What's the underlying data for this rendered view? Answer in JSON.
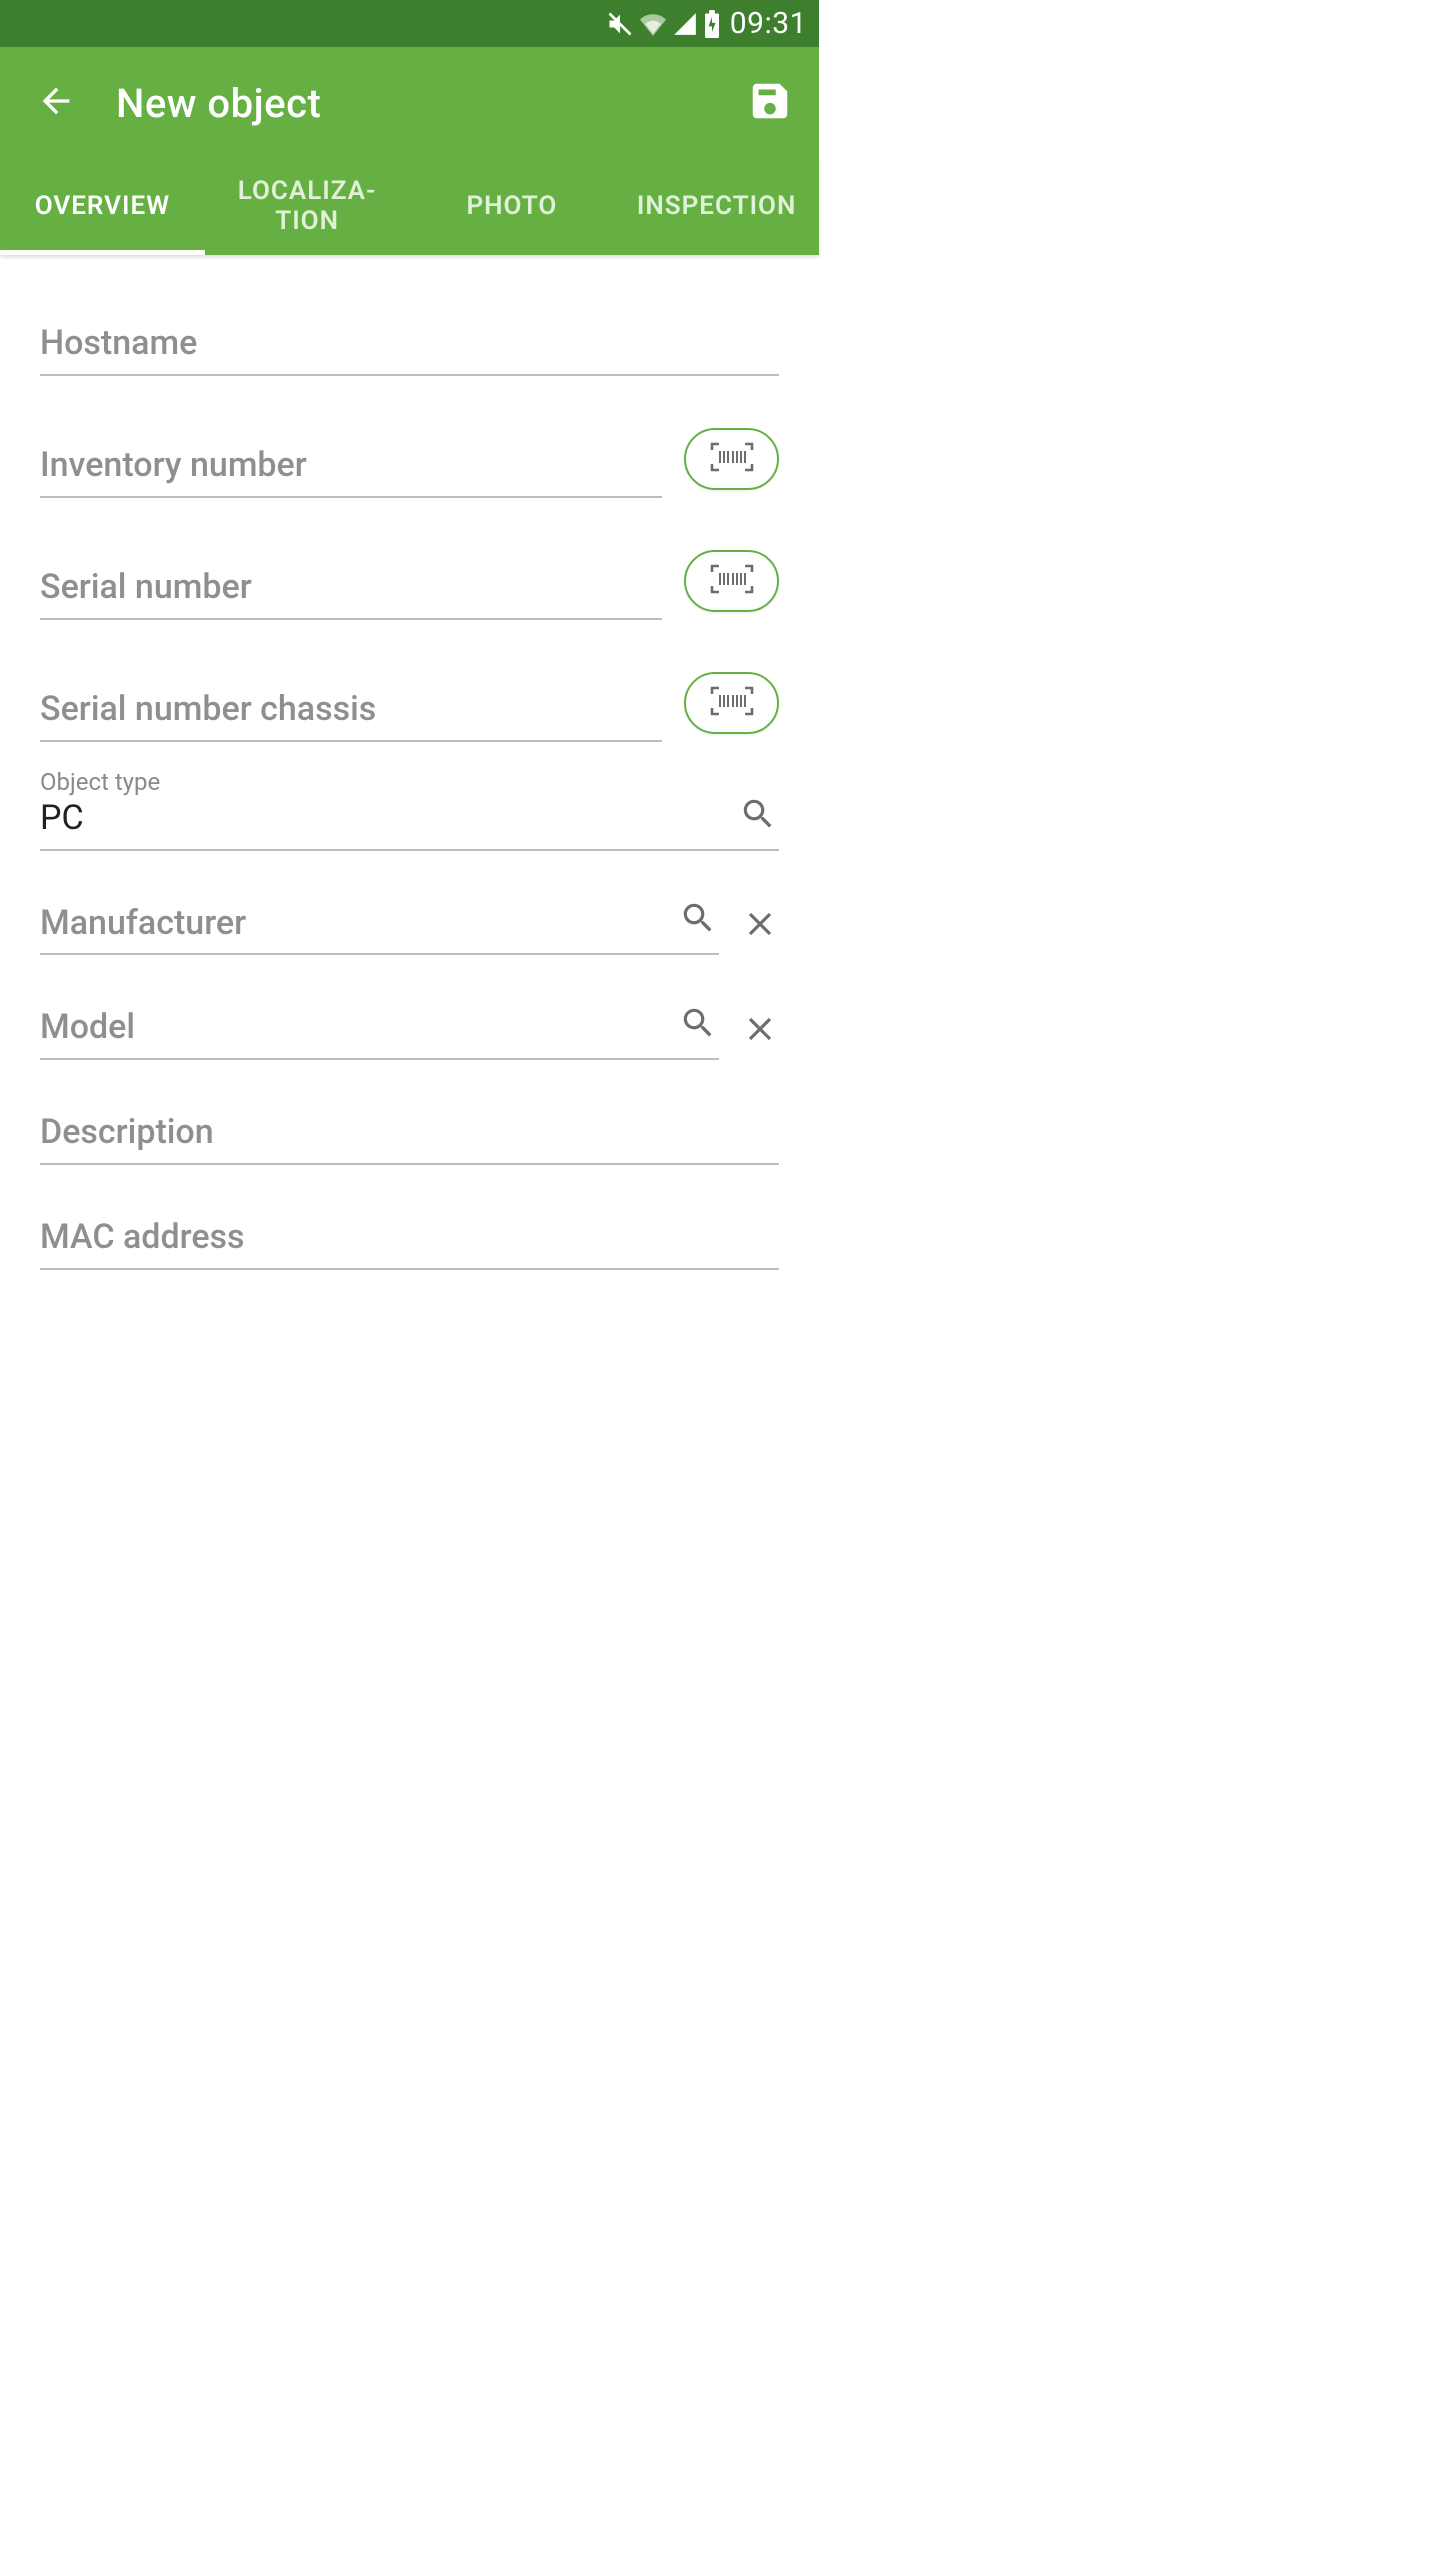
{
  "status": {
    "time": "09:31"
  },
  "header": {
    "title": "New object"
  },
  "tabs": [
    {
      "label": "OVERVIEW",
      "active": true
    },
    {
      "label": "LOCALIZA-\nTION",
      "active": false
    },
    {
      "label": "PHOTO",
      "active": false
    },
    {
      "label": "INSPECTION",
      "active": false
    }
  ],
  "fields": {
    "hostname": {
      "label": "Hostname",
      "placeholder": "Hostname",
      "value": ""
    },
    "inventory_number": {
      "label": "Inventory number",
      "placeholder": "Inventory number",
      "value": ""
    },
    "serial_number": {
      "label": "Serial number",
      "placeholder": "Serial number",
      "value": ""
    },
    "serial_chassis": {
      "label": "Serial number chassis",
      "placeholder": "Serial number chassis",
      "value": ""
    },
    "object_type": {
      "label": "Object type",
      "placeholder": "",
      "value": "PC"
    },
    "manufacturer": {
      "label": "Manufacturer",
      "placeholder": "Manufacturer",
      "value": ""
    },
    "model": {
      "label": "Model",
      "placeholder": "Model",
      "value": ""
    },
    "description": {
      "label": "Description",
      "placeholder": "Description",
      "value": ""
    },
    "mac_address": {
      "label": "MAC address",
      "placeholder": "MAC address",
      "value": ""
    }
  },
  "colors": {
    "status_bar": "#3d7f2d",
    "app_bar": "#66b043",
    "underline": "#bdbdbd",
    "placeholder": "#8f8f8f",
    "text": "#212121",
    "icon_gray": "#6d6d6d"
  }
}
